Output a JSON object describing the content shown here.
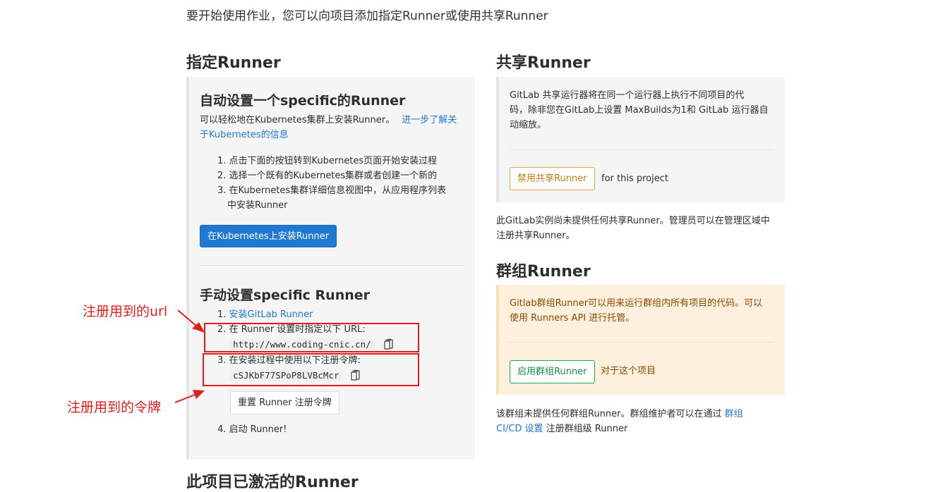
{
  "intro": "要开始使用作业，您可以向项目添加指定Runner或使用共享Runner",
  "specific": {
    "heading": "指定Runner",
    "auto": {
      "title": "自动设置一个specific的Runner",
      "desc": "可以轻松地在Kubernetes集群上安装Runner。",
      "link_part1": "进一步了解关",
      "link_part2": "于Kubernetes的信息",
      "steps": [
        "1. 点击下面的按钮转到Kubernetes页面开始安装过程",
        "2. 选择一个既有的Kubernetes集群或者创建一个新的",
        "3. 在Kubernetes集群详细信息视图中，从应用程序列表",
        "中安装Runner"
      ],
      "install_button": "在Kubernetes上安装Runner"
    },
    "manual": {
      "title": "手动设置specific Runner",
      "step1_prefix": "1. ",
      "step1_link": "安装GitLab Runner",
      "step2": "2. 在 Runner 设置时指定以下 URL:",
      "url": "http://www.coding-cnic.cn/",
      "step3": "3. 在安装过程中使用以下注册令牌:",
      "token": "cSJKbF77SPoP8LVBcMcr",
      "reset_button": "重置 Runner 注册令牌",
      "step4": "4. 启动 Runner!"
    },
    "next_heading_partial": "此项目已激活的Runner"
  },
  "shared": {
    "heading": "共享Runner",
    "desc_lines": [
      "GitLab 共享运行器将在同一个运行器上执行不同项目的代",
      "码，除非您在GitLab上设置 MaxBuilds为1和 GitLab 运行器自",
      "动缩放。"
    ],
    "disable_button": "禁用共享Runner",
    "for_project": "for this project",
    "note_lines": [
      "此GitLab实例尚未提供任何共享Runner。管理员可以在管理区域中",
      "注册共享Runner。"
    ]
  },
  "group": {
    "heading": "群组Runner",
    "desc_lines": [
      "Gitlab群组Runner可以用来运行群组内所有项目的代码。可以",
      "使用 Runners API 进行托管。"
    ],
    "enable_button": "启用群组Runner",
    "for_project": "对于这个项目",
    "note_prefix": "该群组未提供任何群组Runner。群组维护者可以在通过 ",
    "note_link1": "群组",
    "note_link2": "CI/CD 设置",
    "note_suffix": " 注册群组级 Runner"
  },
  "annotations": {
    "url": "注册用到的url",
    "token": "注册用到的令牌"
  },
  "colors": {
    "accent": "#1f78d1",
    "annotation_red": "#e11d1d",
    "warning_panel": "#fdf1dd",
    "success": "#1aaa55"
  }
}
